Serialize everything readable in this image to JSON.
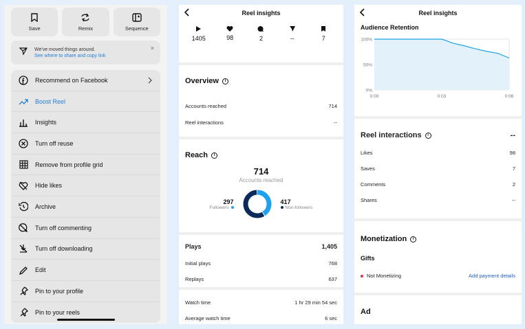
{
  "share_sheet": {
    "top_buttons": [
      {
        "label": "Save",
        "icon": "bookmark-icon"
      },
      {
        "label": "Remix",
        "icon": "remix-icon"
      },
      {
        "label": "Sequence",
        "icon": "sequence-icon"
      }
    ],
    "notice": {
      "text": "We've moved things around.",
      "link": "See where to share and copy link",
      "close": "×"
    },
    "menu": [
      {
        "label": "Recommend on Facebook",
        "icon": "facebook-icon",
        "chevron": true
      },
      {
        "label": "Boost Reel",
        "icon": "trend-up-icon",
        "accent": true
      },
      {
        "label": "Insights",
        "icon": "bar-chart-icon"
      },
      {
        "label": "Turn off reuse",
        "icon": "circle-x-icon"
      },
      {
        "label": "Remove from profile grid",
        "icon": "grid-icon"
      },
      {
        "label": "Hide likes",
        "icon": "heart-slash-icon"
      },
      {
        "label": "Archive",
        "icon": "archive-icon"
      },
      {
        "label": "Turn off commenting",
        "icon": "comment-slash-icon"
      },
      {
        "label": "Turn off downloading",
        "icon": "download-slash-icon"
      },
      {
        "label": "Edit",
        "icon": "pencil-icon"
      },
      {
        "label": "Pin to your profile",
        "icon": "pin-icon"
      },
      {
        "label": "Pin to your reels",
        "icon": "pin-icon"
      }
    ],
    "accent_color": "#1f7fd8"
  },
  "insights_left": {
    "title": "Reel insights",
    "stats": [
      {
        "icon": "play-icon",
        "value": "1405"
      },
      {
        "icon": "heart-icon",
        "value": "98"
      },
      {
        "icon": "comment-icon",
        "value": "2"
      },
      {
        "icon": "send-icon",
        "value": "--"
      },
      {
        "icon": "bookmark-icon",
        "value": "7"
      }
    ],
    "overview": {
      "title": "Overview",
      "rows": [
        {
          "label": "Accounts reached",
          "value": "714"
        },
        {
          "label": "Reel interactions",
          "value": "--"
        }
      ]
    },
    "reach": {
      "title": "Reach",
      "total": "714",
      "total_label": "Accounts reached",
      "followers": {
        "value": "297",
        "label": "Followers",
        "fraction": 0.416,
        "color": "#1fa1f0"
      },
      "non_followers": {
        "value": "417",
        "label": "Non-followers",
        "fraction": 0.584,
        "color": "#0d2a5c"
      }
    },
    "plays": {
      "title": "Plays",
      "value": "1,405",
      "rows": [
        {
          "label": "Initial plays",
          "value": "768"
        },
        {
          "label": "Replays",
          "value": "637"
        }
      ]
    },
    "watch": {
      "rows": [
        {
          "label": "Watch time",
          "value": "1 hr 29 min 54 sec"
        },
        {
          "label": "Average watch time",
          "value": "6 sec"
        }
      ]
    }
  },
  "insights_right": {
    "title": "Reel insights",
    "retention": {
      "title": "Audience Retention",
      "chart_data": {
        "type": "area",
        "title": "Audience Retention",
        "x_ticks": [
          "0:00",
          "0:03",
          "0:06"
        ],
        "y_ticks": [
          "100%",
          "50%",
          "0%"
        ],
        "x": [
          0,
          1,
          2,
          3,
          3.2,
          3.5,
          4,
          4.5,
          5,
          5.5,
          6
        ],
        "y": [
          100,
          100,
          100,
          100,
          97,
          92,
          87,
          81,
          76,
          72,
          63
        ],
        "xlim": [
          0,
          6
        ],
        "ylim": [
          0,
          100
        ],
        "color": "#1aa3e8",
        "fill": "#e3f1fb"
      }
    },
    "interactions": {
      "title": "Reel interactions",
      "value": "--",
      "rows": [
        {
          "label": "Likes",
          "value": "98"
        },
        {
          "label": "Saves",
          "value": "7"
        },
        {
          "label": "Comments",
          "value": "2"
        },
        {
          "label": "Shares",
          "value": "--"
        }
      ]
    },
    "monetization": {
      "title": "Monetization",
      "gifts": "Gifts",
      "status": "Not Monetizing",
      "status_color": "#e0334c",
      "link": "Add payment details"
    },
    "ad": {
      "title": "Ad"
    }
  }
}
